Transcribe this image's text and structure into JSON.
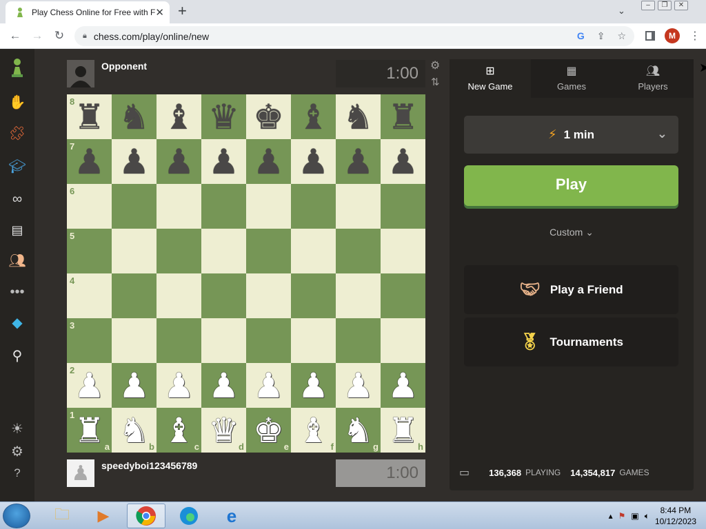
{
  "browser": {
    "tab_title": "Play Chess Online for Free with F",
    "tab_close": "✕",
    "new_tab": "+",
    "url": "chess.com/play/online/new",
    "profile_initial": "M"
  },
  "icons": {
    "favicon": "pawn-icon",
    "back": "arrow-left-icon",
    "forward": "arrow-right-icon",
    "reload": "reload-icon",
    "lock": "lock-icon",
    "google": "google-icon",
    "share": "share-icon",
    "bookmark": "star-icon",
    "sidepanel": "side-panel-icon",
    "menu": "kebab-menu-icon"
  },
  "sidebar": {
    "items": [
      {
        "icon": "chess-logo-icon"
      },
      {
        "icon": "play-hand-icon"
      },
      {
        "icon": "puzzle-icon"
      },
      {
        "icon": "learn-cap-icon"
      },
      {
        "icon": "watch-binoculars-icon"
      },
      {
        "icon": "news-icon"
      },
      {
        "icon": "social-icon"
      },
      {
        "icon": "more-dots-icon"
      },
      {
        "icon": "diamond-icon"
      },
      {
        "icon": "search-icon"
      },
      {
        "icon": "theme-brightness-icon"
      },
      {
        "icon": "settings-gear-icon"
      },
      {
        "icon": "help-icon"
      }
    ]
  },
  "game": {
    "opponent_name": "Opponent",
    "opponent_clock": "1:00",
    "player_name": "speedyboi123456789",
    "player_clock": "1:00",
    "ranks": [
      "8",
      "7",
      "6",
      "5",
      "4",
      "3",
      "2",
      "1"
    ],
    "files": [
      "a",
      "b",
      "c",
      "d",
      "e",
      "f",
      "g",
      "h"
    ],
    "rows": [
      [
        "♜",
        "♞",
        "♝",
        "♛",
        "♚",
        "♝",
        "♞",
        "♜"
      ],
      [
        "♟",
        "♟",
        "♟",
        "♟",
        "♟",
        "♟",
        "♟",
        "♟"
      ],
      [
        "",
        "",
        "",
        "",
        "",
        "",
        "",
        ""
      ],
      [
        "",
        "",
        "",
        "",
        "",
        "",
        "",
        ""
      ],
      [
        "",
        "",
        "",
        "",
        "",
        "",
        "",
        ""
      ],
      [
        "",
        "",
        "",
        "",
        "",
        "",
        "",
        ""
      ],
      [
        "♟",
        "♟",
        "♟",
        "♟",
        "♟",
        "♟",
        "♟",
        "♟"
      ],
      [
        "♜",
        "♞",
        "♝",
        "♛",
        "♚",
        "♝",
        "♞",
        "♜"
      ]
    ],
    "colors": [
      "b",
      "b",
      "",
      "",
      "",
      "",
      "w",
      "w"
    ]
  },
  "panel": {
    "tabs": [
      {
        "label": "New Game",
        "icon": "plus-square-icon"
      },
      {
        "label": "Games",
        "icon": "board-icon"
      },
      {
        "label": "Players",
        "icon": "players-icon"
      }
    ],
    "time_control": "1 min",
    "play_label": "Play",
    "custom_label": "Custom",
    "play_friend_label": "Play a Friend",
    "tournaments_label": "Tournaments",
    "playing_count": "136,368",
    "playing_label": "PLAYING",
    "games_count": "14,354,817",
    "games_label": "GAMES"
  },
  "taskbar": {
    "time": "8:44 PM",
    "date": "10/12/2023",
    "apps": [
      "explorer-icon",
      "media-player-icon",
      "chrome-icon",
      "edge-icon",
      "internet-explorer-icon"
    ]
  },
  "colors": {
    "board_light": "#eeeed2",
    "board_dark": "#769656",
    "play_green": "#81b64c",
    "background": "#312e2b"
  }
}
